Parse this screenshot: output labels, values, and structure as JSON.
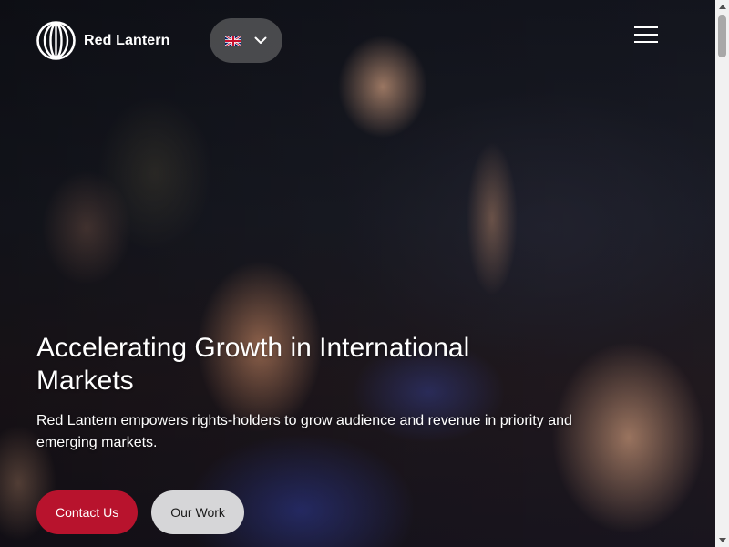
{
  "header": {
    "brand_name": "Red Lantern",
    "logo_icon": "red-lantern-globe-logo-icon",
    "language": {
      "flag_icon": "uk-flag-icon",
      "chevron_icon": "chevron-down-icon"
    },
    "menu_icon": "hamburger-menu-icon"
  },
  "hero": {
    "title": "Accelerating Growth in International Markets",
    "subtitle": "Red Lantern empowers rights-holders to grow audience and revenue in priority and emerging markets.",
    "buttons": {
      "primary_label": "Contact Us",
      "secondary_label": "Our Work"
    }
  },
  "colors": {
    "primary_button": "#b8132d",
    "secondary_button": "#d6d6d8",
    "text": "#ffffff"
  },
  "scrollbar": {
    "position_fraction": 0
  }
}
